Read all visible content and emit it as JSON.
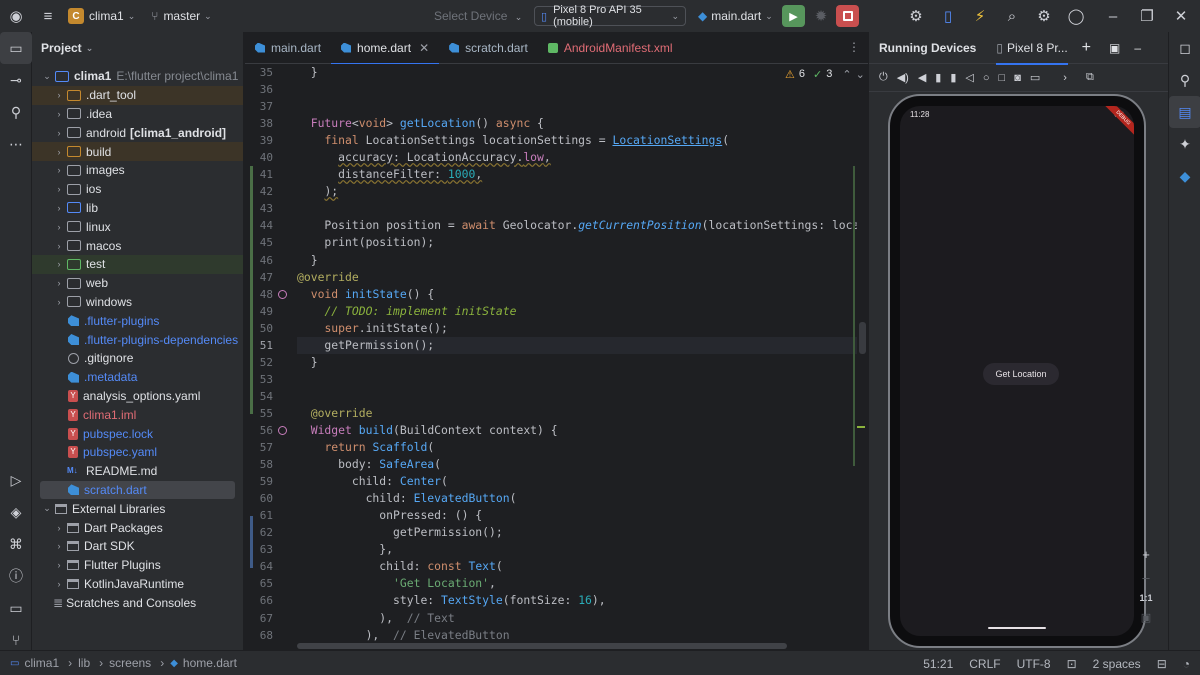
{
  "titlebar": {
    "project_badge": "C",
    "project_name": "clima1",
    "branch": "master",
    "device_placeholder": "Select Device",
    "device": "Pixel 8 Pro API 35 (mobile)",
    "run_config": "main.dart"
  },
  "project_panel": {
    "title": "Project",
    "root_name": "clima1",
    "root_path": "E:\\flutter project\\clima1",
    "items": [
      {
        "label": ".dart_tool",
        "kind": "folder",
        "color": "orange"
      },
      {
        "label": ".idea",
        "kind": "folder",
        "color": "plain"
      },
      {
        "label": "android",
        "suffix": "[clima1_android]",
        "kind": "folder",
        "color": "plain"
      },
      {
        "label": "build",
        "kind": "folder",
        "color": "orange"
      },
      {
        "label": "images",
        "kind": "folder",
        "color": "plain"
      },
      {
        "label": "ios",
        "kind": "folder",
        "color": "plain"
      },
      {
        "label": "lib",
        "kind": "folder",
        "color": "blue"
      },
      {
        "label": "linux",
        "kind": "folder",
        "color": "plain"
      },
      {
        "label": "macos",
        "kind": "folder",
        "color": "plain"
      },
      {
        "label": "test",
        "kind": "folder",
        "color": "green"
      },
      {
        "label": "web",
        "kind": "folder",
        "color": "plain"
      },
      {
        "label": "windows",
        "kind": "folder",
        "color": "plain"
      },
      {
        "label": ".flutter-plugins",
        "kind": "dart",
        "color": "blue"
      },
      {
        "label": ".flutter-plugins-dependencies",
        "kind": "dart",
        "color": "blue"
      },
      {
        "label": ".gitignore",
        "kind": "ignore",
        "color": "plain"
      },
      {
        "label": ".metadata",
        "kind": "dart",
        "color": "blue"
      },
      {
        "label": "analysis_options.yaml",
        "kind": "yaml",
        "color": "plain"
      },
      {
        "label": "clima1.iml",
        "kind": "yaml",
        "color": "red"
      },
      {
        "label": "pubspec.lock",
        "kind": "yaml",
        "color": "blue"
      },
      {
        "label": "pubspec.yaml",
        "kind": "yaml",
        "color": "blue"
      },
      {
        "label": "README.md",
        "kind": "md",
        "color": "plain"
      },
      {
        "label": "scratch.dart",
        "kind": "dart",
        "color": "blue"
      }
    ],
    "external": {
      "label": "External Libraries",
      "children": [
        "Dart Packages",
        "Dart SDK",
        "Flutter Plugins",
        "KotlinJavaRuntime"
      ]
    },
    "scratches": "Scratches and Consoles"
  },
  "editor": {
    "tabs": [
      "main.dart",
      "home.dart",
      "scratch.dart",
      "AndroidManifest.xml"
    ],
    "active_tab": "home.dart",
    "warnings": "6",
    "weak_warnings": "3",
    "first_line": 35,
    "current_line": 51
  },
  "running_devices": {
    "title": "Running Devices",
    "tab": "Pixel 8 Pr...",
    "status_time": "11:28",
    "debug_label": "DEBUG",
    "button_label": "Get Location",
    "zoom_label": "1:1"
  },
  "statusbar": {
    "crumbs": [
      "clima1",
      "lib",
      "screens",
      "home.dart"
    ],
    "position": "51:21",
    "line_sep": "CRLF",
    "encoding": "UTF-8",
    "indent": "2 spaces"
  },
  "colors": {
    "accent": "#3574f0",
    "run_green": "#57965c",
    "stop_red": "#c94f4f",
    "project_badge": "#c4892e"
  }
}
